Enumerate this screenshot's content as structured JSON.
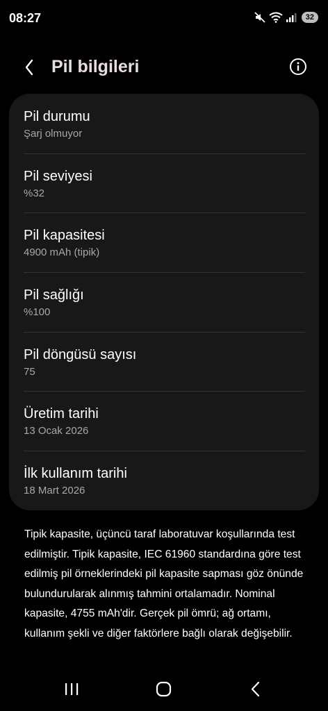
{
  "status": {
    "time": "08:27",
    "battery_level": "32",
    "icons": [
      "mute-icon",
      "wifi-icon",
      "signal-icon",
      "battery-icon"
    ]
  },
  "header": {
    "title": "Pil bilgileri",
    "back_icon": "chevron-left-icon",
    "info_icon": "info-icon"
  },
  "rows": [
    {
      "title": "Pil durumu",
      "value": "Şarj olmuyor"
    },
    {
      "title": "Pil seviyesi",
      "value": "%32"
    },
    {
      "title": "Pil kapasitesi",
      "value": "4900 mAh (tipik)"
    },
    {
      "title": "Pil sağlığı",
      "value": "%100"
    },
    {
      "title": "Pil döngüsü sayısı",
      "value": "75"
    },
    {
      "title": "Üretim tarihi",
      "value": "13 Ocak 2026"
    },
    {
      "title": "İlk kullanım tarihi",
      "value": "18 Mart 2026"
    }
  ],
  "footnote": "Tipik kapasite, üçüncü taraf laboratuvar koşullarında test edilmiştir. Tipik kapasite, IEC 61960 standardına göre test edilmiş pil örneklerindeki pil kapasite sapması göz önünde bulundurularak alınmış tahmini ortalamadır. Nominal kapasite, 4755 mAh'dir. Gerçek pil ömrü; ağ ortamı, kullanım şekli ve diğer faktörlere bağlı olarak değişebilir.",
  "nav": {
    "recents_icon": "recent-apps-icon",
    "home_icon": "home-icon",
    "back_icon": "back-icon"
  },
  "colors": {
    "background": "#000000",
    "card": "#181818",
    "title": "#e8dede",
    "secondary_text": "#a8a8a8"
  }
}
